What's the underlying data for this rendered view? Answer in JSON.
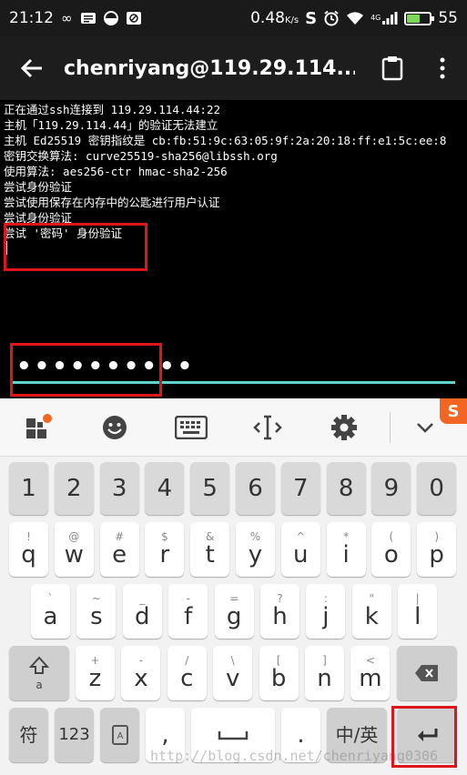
{
  "status_bar": {
    "time": "21:12",
    "speed": "0.48",
    "speed_unit": "K/s",
    "network": "4G",
    "battery": "55"
  },
  "app_bar": {
    "title": "chenriyang@119.29.114..."
  },
  "terminal": {
    "lines": [
      "正在通过ssh连接到 119.29.114.44:22",
      "主机「119.29.114.44」的验证无法建立",
      "主机 Ed25519 密钥指纹是 cb:fb:51:9c:63:05:9f:2a:20:18:ff:e1:5c:ee:8",
      "密钥交换算法: curve25519-sha256@libssh.org",
      "使用算法: aes256-ctr hmac-sha2-256",
      "尝试身份验证",
      "尝试使用保存在内存中的公匙进行用户认证",
      "尝试身份验证",
      "尝试 '密码' 身份验证"
    ],
    "password_mask": "••••••••••"
  },
  "keyboard": {
    "number_row": [
      "1",
      "2",
      "3",
      "4",
      "5",
      "6",
      "7",
      "8",
      "9",
      "0"
    ],
    "row1": [
      {
        "main": "q",
        "sub": "!"
      },
      {
        "main": "w",
        "sub": "@"
      },
      {
        "main": "e",
        "sub": "#"
      },
      {
        "main": "r",
        "sub": "$"
      },
      {
        "main": "t",
        "sub": "&"
      },
      {
        "main": "y",
        "sub": "%"
      },
      {
        "main": "u",
        "sub": "^"
      },
      {
        "main": "i",
        "sub": "*"
      },
      {
        "main": "o",
        "sub": "("
      },
      {
        "main": "p",
        "sub": ")"
      }
    ],
    "row2": [
      {
        "main": "a",
        "sub": "`"
      },
      {
        "main": "s",
        "sub": "~"
      },
      {
        "main": "d",
        "sub": "_"
      },
      {
        "main": "f",
        "sub": "-"
      },
      {
        "main": "g",
        "sub": "="
      },
      {
        "main": "h",
        "sub": "?"
      },
      {
        "main": "j",
        "sub": ":"
      },
      {
        "main": "k",
        "sub": "\""
      },
      {
        "main": "l",
        "sub": "|"
      }
    ],
    "row3": [
      {
        "main": "z",
        "sub": "+"
      },
      {
        "main": "x",
        "sub": "-"
      },
      {
        "main": "c",
        "sub": "/"
      },
      {
        "main": "v",
        "sub": "\\"
      },
      {
        "main": "b",
        "sub": "["
      },
      {
        "main": "n",
        "sub": "]"
      },
      {
        "main": "m",
        "sub": "<"
      }
    ],
    "shift_sub": "a",
    "symbol_label": "符",
    "num_label": "123",
    "comma_label": ",",
    "period_label": ".",
    "lang_label": "中/英",
    "toolbar_icons": [
      "apps-icon",
      "emoji-icon",
      "keyboard-icon",
      "cursor-icon",
      "settings-icon",
      "collapse-icon"
    ]
  },
  "watermark": "http://blog.csdn.net/chenriyang0306"
}
